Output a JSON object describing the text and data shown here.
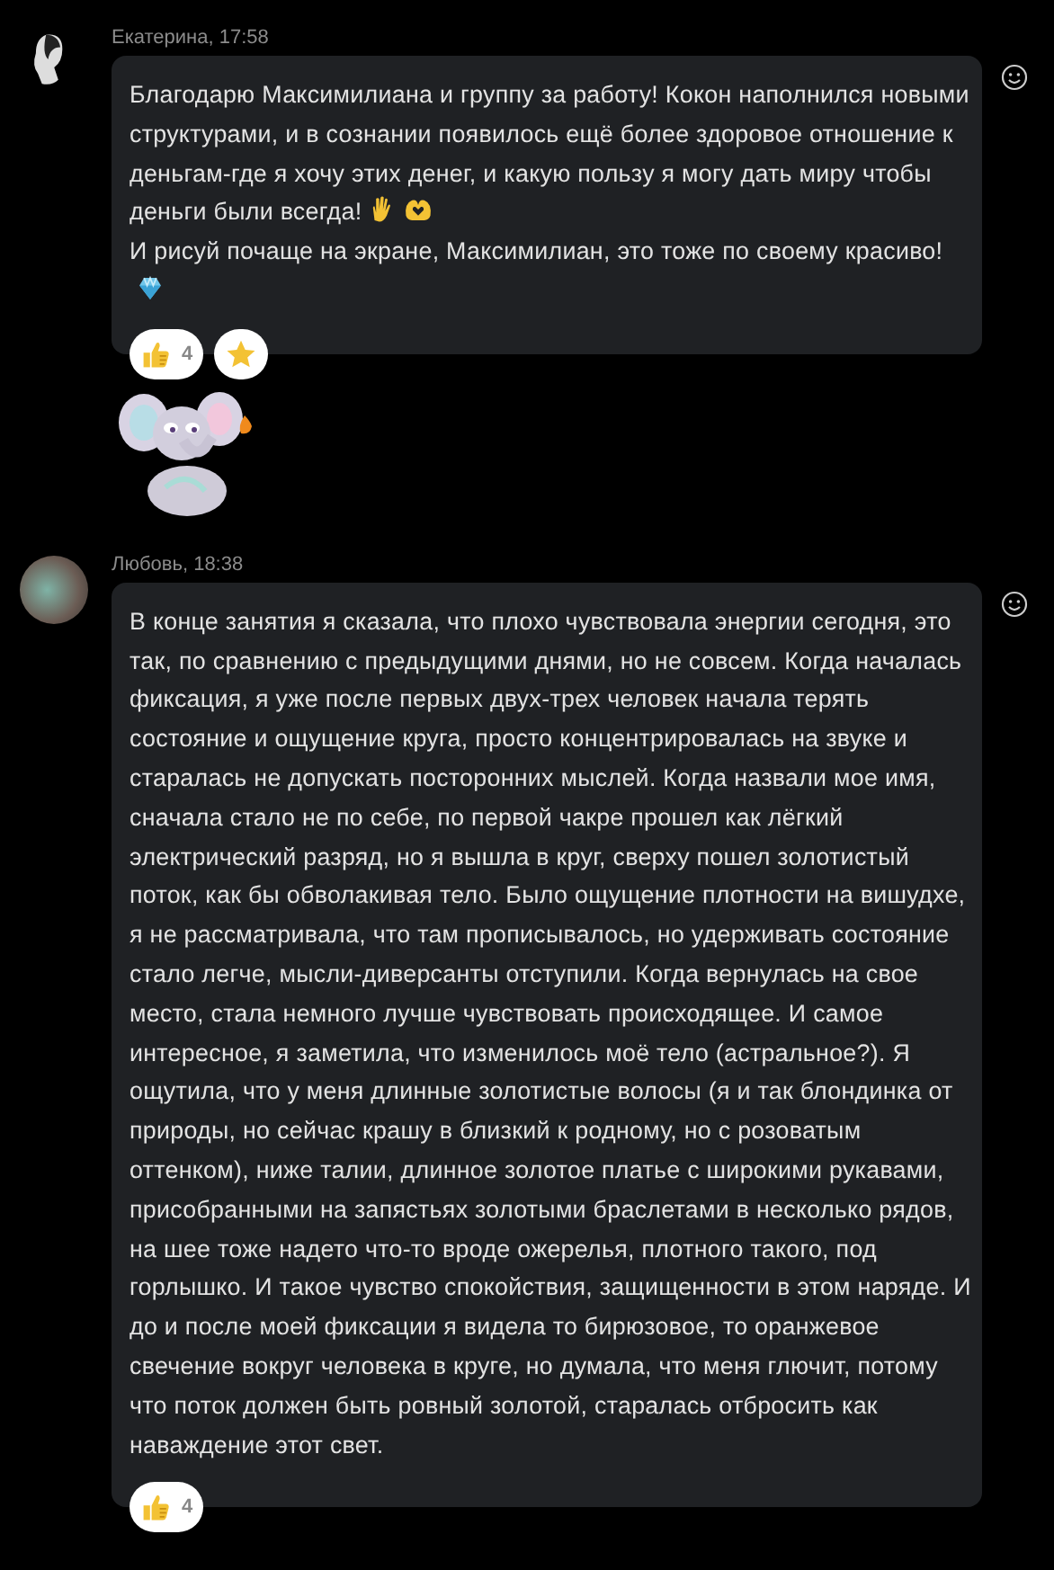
{
  "messages": [
    {
      "author": "Екатерина, 17:58",
      "avatar": {
        "kind": "drawing"
      },
      "parts": [
        {
          "kind": "text",
          "text": "Благодарю Максимилиана и группу за  работу! Кокон наполнился новыми структурами, и в сознании появилось ещё более здоровое отношение к деньгам-где я хочу этих денег, и какую пользу я могу дать миру чтобы деньги были всегда!"
        },
        {
          "kind": "hand"
        },
        {
          "kind": "heartHands"
        },
        {
          "kind": "break"
        },
        {
          "kind": "text",
          "text": "И рисуй почаще на экране, Максимилиан, это тоже по своему красиво!"
        },
        {
          "kind": "gem"
        }
      ],
      "reactions": [
        {
          "kind": "thumbs",
          "count": "4"
        },
        {
          "kind": "star"
        }
      ],
      "attachments": [
        {
          "kind": "elephant"
        }
      ]
    },
    {
      "author": "Любовь, 18:38",
      "avatar": {
        "kind": "photo"
      },
      "parts": [
        {
          "kind": "text",
          "text": "В конце занятия я сказала, что плохо чувствовала энергии сегодня, это так, по сравнению с предыдущими днями, но не совсем. Когда началась фиксация, я уже после первых двух-трех человек начала терять состояние и ощущение круга, просто концентрировалась на звуке и старалась не допускать посторонних мыслей. Когда назвали мое имя, сначала стало не по себе, по первой чакре прошел как лёгкий электрический разряд, но я вышла в круг, сверху пошел золотистый поток, как бы обволакивая тело. Было ощущение плотности на вишудхе, я не рассматривала, что там прописывалось, но удерживать состояние стало легче, мысли-диверсанты отступили. Когда вернулась на свое место, стала немного лучше чувствовать происходящее. И самое интересное, я заметила, что изменилось моё тело (астральное?). Я ощутила, что у меня длинные золотистые волосы (я и так блондинка от природы, но сейчас крашу в близкий к родному, но с розоватым оттенком), ниже талии, длинное золотое платье с широкими рукавами, присобранными на запястьях золотыми браслетами в несколько рядов, на шее тоже надето что-то вроде ожерелья, плотного такого, под горлышко. И такое чувство спокойствия, защищенности в этом наряде. И до и после моей фиксации я видела то бирюзовое, то оранжевое свечение вокруг человека в круге, но думала, что меня глючит, потому что поток должен быть ровный золотой, старалась отбросить как наваждение этот свет."
        }
      ],
      "reactions": [
        {
          "kind": "thumbs",
          "count": "4"
        }
      ]
    }
  ]
}
